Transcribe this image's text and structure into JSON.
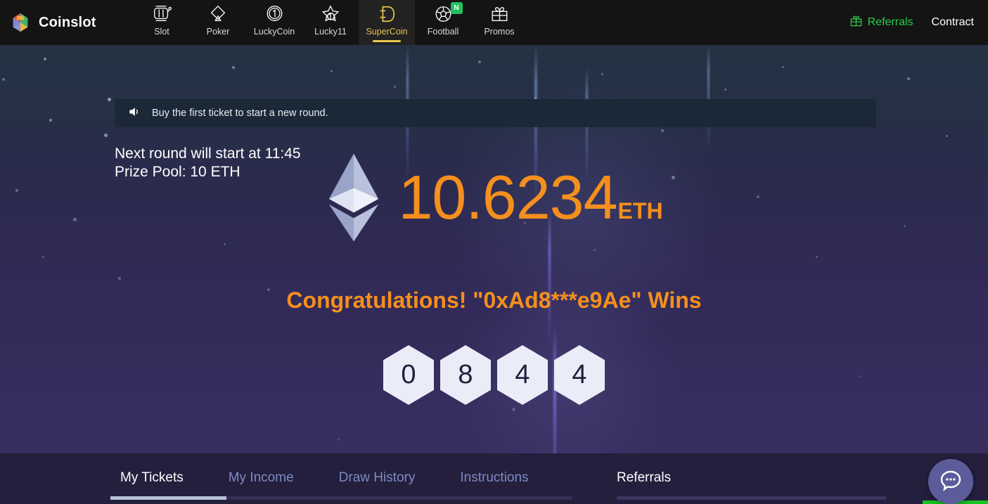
{
  "brand": {
    "name": "Coinslot",
    "logo_icon": "coinslot-polygon-logo"
  },
  "nav": {
    "items": [
      {
        "label": "Slot",
        "icon": "slot-machine-icon",
        "active": false,
        "badge": ""
      },
      {
        "label": "Poker",
        "icon": "spade-icon",
        "active": false,
        "badge": ""
      },
      {
        "label": "LuckyCoin",
        "icon": "coin-one-icon",
        "active": false,
        "badge": ""
      },
      {
        "label": "Lucky11",
        "icon": "star-ball-icon",
        "active": false,
        "badge": ""
      },
      {
        "label": "SuperCoin",
        "icon": "letter-d-icon",
        "active": true,
        "badge": ""
      },
      {
        "label": "Football",
        "icon": "football-icon",
        "active": false,
        "badge": "N"
      },
      {
        "label": "Promos",
        "icon": "gift-icon",
        "active": false,
        "badge": ""
      }
    ]
  },
  "header_right": {
    "referrals_label": "Referrals",
    "referrals_icon": "gift-icon",
    "contract_label": "Contract"
  },
  "announcement": {
    "icon": "speaker-icon",
    "text": "Buy the first ticket to start a new round."
  },
  "hero": {
    "next_round_text": "Next round will start at 11:45",
    "prize_pool_text": "Prize Pool: 10 ETH",
    "eth_icon": "ethereum-diamond-icon",
    "amount_value": "10.6234",
    "amount_unit": "ETH",
    "winner_text": "Congratulations! \"0xAd8***e9Ae\" Wins",
    "draw_digits": [
      "0",
      "8",
      "4",
      "4"
    ]
  },
  "footer": {
    "tabs": [
      {
        "label": "My Tickets",
        "active": true
      },
      {
        "label": "My Income",
        "active": false
      },
      {
        "label": "Draw History",
        "active": false
      },
      {
        "label": "Instructions",
        "active": false
      }
    ],
    "referrals_title": "Referrals"
  },
  "chat": {
    "icon": "chat-bubble-icon"
  },
  "colors": {
    "accent_orange": "#f58f1e",
    "accent_yellow": "#e8c54a",
    "accent_green": "#2ecc4f",
    "header_bg": "#141414",
    "footer_bg": "#231f3d",
    "announce_bg": "#1b2838",
    "tab_inactive": "#7f8bc4"
  }
}
